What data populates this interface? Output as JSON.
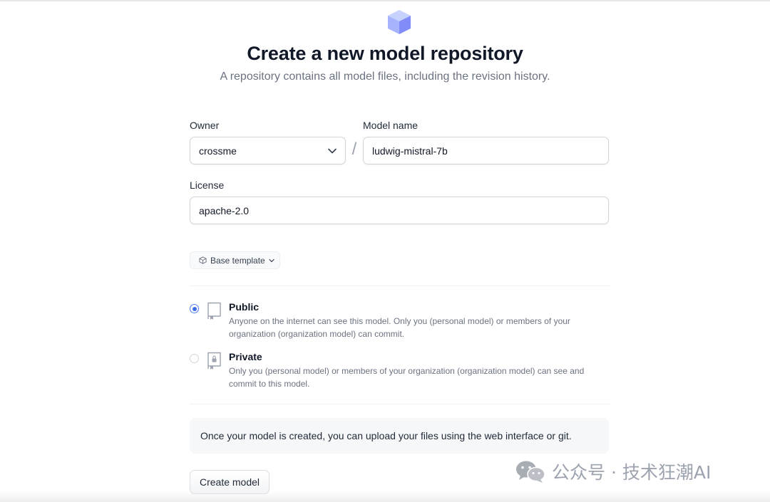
{
  "header": {
    "title": "Create a new model repository",
    "subtitle": "A repository contains all model files, including the revision history."
  },
  "form": {
    "owner_label": "Owner",
    "owner_value": "crossme",
    "separator": "/",
    "model_name_label": "Model name",
    "model_name_value": "ludwig-mistral-7b",
    "license_label": "License",
    "license_value": "apache-2.0",
    "template_label": "Base template"
  },
  "visibility": {
    "options": [
      {
        "title": "Public",
        "description": "Anyone on the internet can see this model. Only you (personal model) or members of your organization (organization model) can commit.",
        "selected": true
      },
      {
        "title": "Private",
        "description": "Only you (personal model) or members of your organization (organization model) can see and commit to this model.",
        "selected": false
      }
    ]
  },
  "notice": "Once your model is created, you can upload your files using the web interface or git.",
  "submit_label": "Create model",
  "watermark": "公众号 · 技术狂潮AI",
  "colors": {
    "logo": "#a5b4fc",
    "radio_selected": "#3b6fe8",
    "muted_text": "#6b7280"
  }
}
